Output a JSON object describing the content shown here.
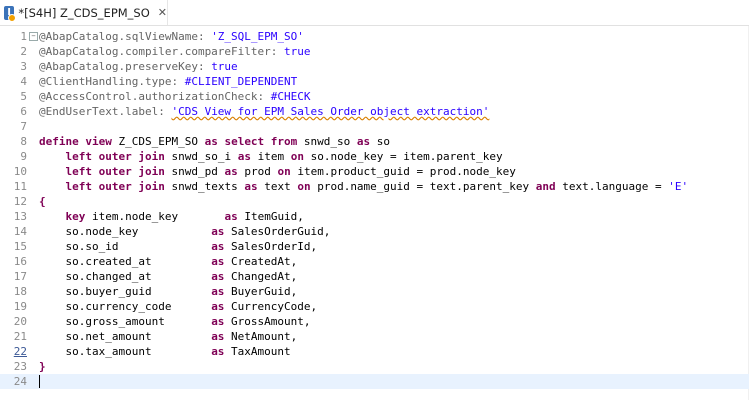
{
  "tab": {
    "title": "*[S4H] Z_CDS_EPM_SO",
    "icon_label": "I",
    "close": "✕"
  },
  "editor": {
    "lines": [
      {
        "n": "1",
        "fold": "−",
        "tokens": [
          [
            "ann",
            "@AbapCatalog.sqlViewName: "
          ],
          [
            "str",
            "'Z_SQL_EPM_SO'"
          ]
        ]
      },
      {
        "n": "2",
        "tokens": [
          [
            "ann",
            "@AbapCatalog.compiler.compareFilter: "
          ],
          [
            "str",
            "true"
          ]
        ]
      },
      {
        "n": "3",
        "tokens": [
          [
            "ann",
            "@AbapCatalog.preserveKey: "
          ],
          [
            "str",
            "true"
          ]
        ]
      },
      {
        "n": "4",
        "tokens": [
          [
            "ann",
            "@ClientHandling.type: "
          ],
          [
            "str",
            "#CLIENT_DEPENDENT"
          ]
        ]
      },
      {
        "n": "5",
        "tokens": [
          [
            "ann",
            "@AccessControl.authorizationCheck: "
          ],
          [
            "str",
            "#CHECK"
          ]
        ]
      },
      {
        "n": "6",
        "tokens": [
          [
            "ann",
            "@EndUserText.label: "
          ],
          [
            "strsq",
            "'CDS View for EPM Sales Order object extraction'"
          ]
        ]
      },
      {
        "n": "7",
        "tokens": []
      },
      {
        "n": "8",
        "tokens": [
          [
            "kw",
            "define view"
          ],
          [
            "id",
            " Z_CDS_EPM_SO "
          ],
          [
            "kw",
            "as select from"
          ],
          [
            "id",
            " snwd_so "
          ],
          [
            "kw",
            "as"
          ],
          [
            "id",
            " so"
          ]
        ]
      },
      {
        "n": "9",
        "tokens": [
          [
            "id",
            "    "
          ],
          [
            "kw",
            "left outer join"
          ],
          [
            "id",
            " snwd_so_i "
          ],
          [
            "kw",
            "as"
          ],
          [
            "id",
            " item "
          ],
          [
            "kw",
            "on"
          ],
          [
            "id",
            " so.node_key = item.parent_key"
          ]
        ]
      },
      {
        "n": "10",
        "tokens": [
          [
            "id",
            "    "
          ],
          [
            "kw",
            "left outer join"
          ],
          [
            "id",
            " snwd_pd "
          ],
          [
            "kw",
            "as"
          ],
          [
            "id",
            " prod "
          ],
          [
            "kw",
            "on"
          ],
          [
            "id",
            " item.product_guid = prod.node_key"
          ]
        ]
      },
      {
        "n": "11",
        "tokens": [
          [
            "id",
            "    "
          ],
          [
            "kw",
            "left outer join"
          ],
          [
            "id",
            " snwd_texts "
          ],
          [
            "kw",
            "as"
          ],
          [
            "id",
            " text "
          ],
          [
            "kw",
            "on"
          ],
          [
            "id",
            " prod.name_guid = text.parent_key "
          ],
          [
            "kw",
            "and"
          ],
          [
            "id",
            " text.language = "
          ],
          [
            "str",
            "'E'"
          ]
        ]
      },
      {
        "n": "12",
        "tokens": [
          [
            "kw",
            "{"
          ]
        ]
      },
      {
        "n": "13",
        "tokens": [
          [
            "id",
            "    "
          ],
          [
            "kw",
            "key"
          ],
          [
            "id",
            " item.node_key       "
          ],
          [
            "kw",
            "as"
          ],
          [
            "id",
            " ItemGuid,"
          ]
        ]
      },
      {
        "n": "14",
        "tokens": [
          [
            "id",
            "    so.node_key           "
          ],
          [
            "kw",
            "as"
          ],
          [
            "id",
            " SalesOrderGuid,"
          ]
        ]
      },
      {
        "n": "15",
        "tokens": [
          [
            "id",
            "    so.so_id              "
          ],
          [
            "kw",
            "as"
          ],
          [
            "id",
            " SalesOrderId,"
          ]
        ]
      },
      {
        "n": "16",
        "tokens": [
          [
            "id",
            "    so.created_at         "
          ],
          [
            "kw",
            "as"
          ],
          [
            "id",
            " CreatedAt,"
          ]
        ]
      },
      {
        "n": "17",
        "tokens": [
          [
            "id",
            "    so.changed_at         "
          ],
          [
            "kw",
            "as"
          ],
          [
            "id",
            " ChangedAt,"
          ]
        ]
      },
      {
        "n": "18",
        "tokens": [
          [
            "id",
            "    so.buyer_guid         "
          ],
          [
            "kw",
            "as"
          ],
          [
            "id",
            " BuyerGuid,"
          ]
        ]
      },
      {
        "n": "19",
        "tokens": [
          [
            "id",
            "    so.currency_code      "
          ],
          [
            "kw",
            "as"
          ],
          [
            "id",
            " CurrencyCode,"
          ]
        ]
      },
      {
        "n": "20",
        "tokens": [
          [
            "id",
            "    so.gross_amount       "
          ],
          [
            "kw",
            "as"
          ],
          [
            "id",
            " GrossAmount,"
          ]
        ]
      },
      {
        "n": "21",
        "tokens": [
          [
            "id",
            "    so.net_amount         "
          ],
          [
            "kw",
            "as"
          ],
          [
            "id",
            " NetAmount,"
          ]
        ]
      },
      {
        "n": "22",
        "active": true,
        "tokens": [
          [
            "id",
            "    so.tax_amount         "
          ],
          [
            "kw",
            "as"
          ],
          [
            "id",
            " TaxAmount"
          ]
        ]
      },
      {
        "n": "23",
        "tokens": [
          [
            "kw",
            "}"
          ]
        ]
      },
      {
        "n": "24",
        "current": true,
        "tokens": []
      }
    ]
  }
}
